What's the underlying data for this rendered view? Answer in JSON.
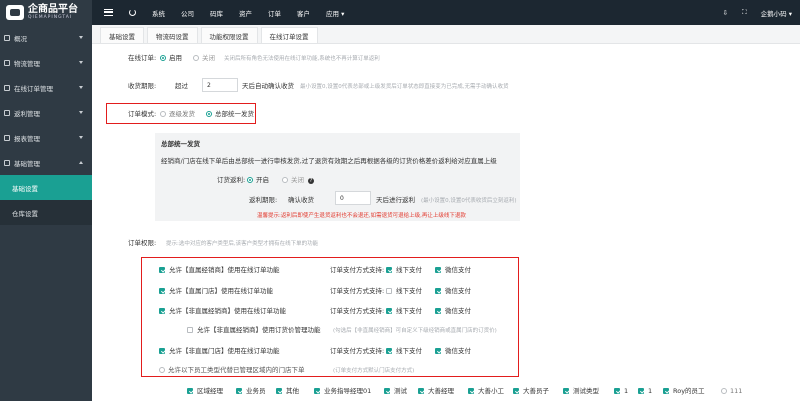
{
  "brand": {
    "title": "企商品平台",
    "subtitle": "QIEMAPINGTAI"
  },
  "sidebar": {
    "items": [
      {
        "label": "概况",
        "open": false
      },
      {
        "label": "物流管理",
        "open": false
      },
      {
        "label": "在线订单管理",
        "open": false
      },
      {
        "label": "返利管理",
        "open": false
      },
      {
        "label": "报表管理",
        "open": false
      },
      {
        "label": "基础管理",
        "open": true
      }
    ],
    "subitems": [
      {
        "label": "基础设置",
        "active": true
      },
      {
        "label": "仓库设置",
        "active": false
      }
    ]
  },
  "topbar": {
    "items": [
      "系统",
      "公司",
      "码库",
      "资产",
      "订单",
      "客户",
      "应用 ▾"
    ],
    "user": "企鹅小码 ▾"
  },
  "tabs": [
    "基础设置",
    "物流码设置",
    "功能权限设置",
    "在线订单设置"
  ],
  "online": {
    "label": "在线订单:",
    "opt_on": "启用",
    "opt_off": "关闭",
    "hint": "关闭后所有角色无法使用在线订单功能,系统也不再计算订单返利"
  },
  "receipt": {
    "label": "收货期限:",
    "prefix": "超过",
    "value": "2",
    "suffix": "天后自动确认收货",
    "hint": "最小设置0,设置0代表总部或上级发货后订单状态即直接变为已完成,无需手动确认收货"
  },
  "mode": {
    "label": "订单模式:",
    "opt1": "逐级发货",
    "opt2": "总部统一发货"
  },
  "panel": {
    "title": "总部统一发货",
    "desc": "经销商/门店在线下单后由总部统一进行审核发货,过了退货有效期之后再根据各级的订货价格差价返利给对应直属上级",
    "rebate_label": "订货返利:",
    "rebate_on": "开启",
    "rebate_off": "关闭",
    "help": "?",
    "period_label": "返利期限:",
    "period_prefix": "确认收货",
    "period_value": "0",
    "period_suffix": "天后进行返利",
    "period_hint": "(最小设置0,设置0代表收货后立刻返利)",
    "warning": "温馨提示:返利后即使产生退货返利也不会退还,如需退货可退给上级,再让上级线下退款"
  },
  "permission": {
    "label": "订单权限:",
    "hint": "提示:选中对应的客户类型后,该客户类型才拥有在线下单的功能"
  },
  "perms": [
    {
      "text": "允许【直属经销商】使用在线订单功能",
      "checked": true,
      "pay_label": "订单支付方式支持:",
      "pay1": "线下支付",
      "pay1_checked": true,
      "pay2": "微信支付",
      "pay2_checked": true
    },
    {
      "text": "允许【直属门店】使用在线订单功能",
      "checked": true,
      "pay_label": "订单支付方式支持:",
      "pay1": "线下支付",
      "pay1_checked": false,
      "pay2": "微信支付",
      "pay2_checked": true
    },
    {
      "text": "允许【非直属经销商】使用在线订单功能",
      "checked": true,
      "pay_label": "订单支付方式支持:",
      "pay1": "线下支付",
      "pay1_checked": true,
      "pay2": "微信支付",
      "pay2_checked": true
    },
    {
      "text": "允许【非直属门店】使用在线订单功能",
      "checked": true,
      "pay_label": "订单支付方式支持:",
      "pay1": "线下支付",
      "pay1_checked": true,
      "pay2": "微信支付",
      "pay2_checked": true
    }
  ],
  "sub_perm": {
    "text": "允许【非直属经销商】使用订货价管理功能",
    "hint": "(勾选后【非直属经销商】可自定义下级经销商或直属门店的订货价)"
  },
  "lower": {
    "text": "允许以下员工类型代替已管理区域内的门店下单",
    "hint": "(订单支付方式默认门店支付方式)"
  },
  "staff": [
    {
      "label": "区域经理",
      "checked": true
    },
    {
      "label": "业务员",
      "checked": true
    },
    {
      "label": "其他",
      "checked": true
    },
    {
      "label": "业务指导经理01",
      "checked": true
    },
    {
      "label": "测试",
      "checked": true
    },
    {
      "label": "大善经理",
      "checked": true
    },
    {
      "label": "大善小工",
      "checked": true
    },
    {
      "label": "大善员子",
      "checked": true
    },
    {
      "label": "测试类型",
      "checked": true
    },
    {
      "label": "1",
      "checked": true
    },
    {
      "label": "1",
      "checked": true
    },
    {
      "label": "Roy的员工",
      "checked": true
    },
    {
      "label": "111",
      "checked": false
    }
  ],
  "colors": {
    "accent": "#1aa093",
    "sidebar": "#2f3a44",
    "topbar": "#1c2731",
    "highlight": "#e21d1d"
  }
}
